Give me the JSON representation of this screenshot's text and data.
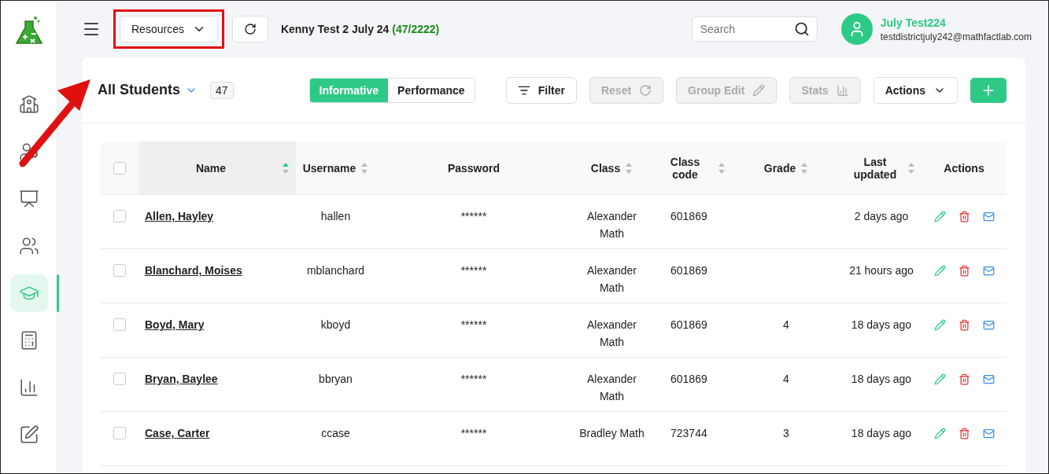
{
  "header": {
    "resources_button": "Resources",
    "context": {
      "title": "Kenny Test 2 July 24",
      "count": "(47/2222)"
    },
    "search": {
      "placeholder": "Search"
    },
    "user": {
      "name": "July Test224",
      "email": "testdistrictjuly242@mathfactlab.com"
    }
  },
  "sidebar": {
    "items": [
      {
        "selected": false
      },
      {
        "selected": false
      },
      {
        "selected": false
      },
      {
        "selected": false
      },
      {
        "selected": true
      },
      {
        "selected": false
      },
      {
        "selected": false
      },
      {
        "selected": false
      }
    ]
  },
  "toolbar": {
    "title": "All Students",
    "count": "47",
    "view_tabs": [
      {
        "label": "Informative",
        "selected": true
      },
      {
        "label": "Performance",
        "selected": false
      }
    ],
    "buttons": [
      {
        "label": "Filter",
        "kind": "filter",
        "disabled": false
      },
      {
        "label": "Reset",
        "kind": "reset",
        "disabled": true
      },
      {
        "label": "Group Edit",
        "kind": "edit",
        "disabled": true
      },
      {
        "label": "Stats",
        "kind": "stats",
        "disabled": true
      },
      {
        "label": "Actions",
        "kind": "menu",
        "disabled": false
      }
    ]
  },
  "table": {
    "all_checked": false,
    "columns": [
      {
        "label": "Name",
        "sortable": true,
        "sorted": true
      },
      {
        "label": "Username",
        "sortable": true,
        "sorted": false
      },
      {
        "label": "Password",
        "sortable": false,
        "sorted": false
      },
      {
        "label": "Class",
        "sortable": true,
        "sorted": false
      },
      {
        "label": "Class code",
        "sortable": true,
        "sorted": false
      },
      {
        "label": "Grade",
        "sortable": true,
        "sorted": false
      },
      {
        "label": "Last updated",
        "sortable": true,
        "sorted": false
      },
      {
        "label": "Actions",
        "sortable": false,
        "sorted": false
      }
    ],
    "rows": [
      {
        "checked": false,
        "name": "Allen, Hayley",
        "username": "hallen",
        "password": "******",
        "class": "Alexander Math",
        "class_code": "601869",
        "grade": "",
        "last_updated": "2 days ago"
      },
      {
        "checked": false,
        "name": "Blanchard, Moises",
        "username": "mblanchard",
        "password": "******",
        "class": "Alexander Math",
        "class_code": "601869",
        "grade": "",
        "last_updated": "21 hours ago"
      },
      {
        "checked": false,
        "name": "Boyd, Mary",
        "username": "kboyd",
        "password": "******",
        "class": "Alexander Math",
        "class_code": "601869",
        "grade": "4",
        "last_updated": "18 days ago"
      },
      {
        "checked": false,
        "name": "Bryan, Baylee",
        "username": "bbryan",
        "password": "******",
        "class": "Alexander Math",
        "class_code": "601869",
        "grade": "4",
        "last_updated": "18 days ago"
      },
      {
        "checked": false,
        "name": "Case, Carter",
        "username": "ccase",
        "password": "******",
        "class": "Bradley Math",
        "class_code": "723744",
        "grade": "3",
        "last_updated": "18 days ago"
      }
    ]
  },
  "annotations": {
    "highlight_box": true,
    "arrow": true
  }
}
